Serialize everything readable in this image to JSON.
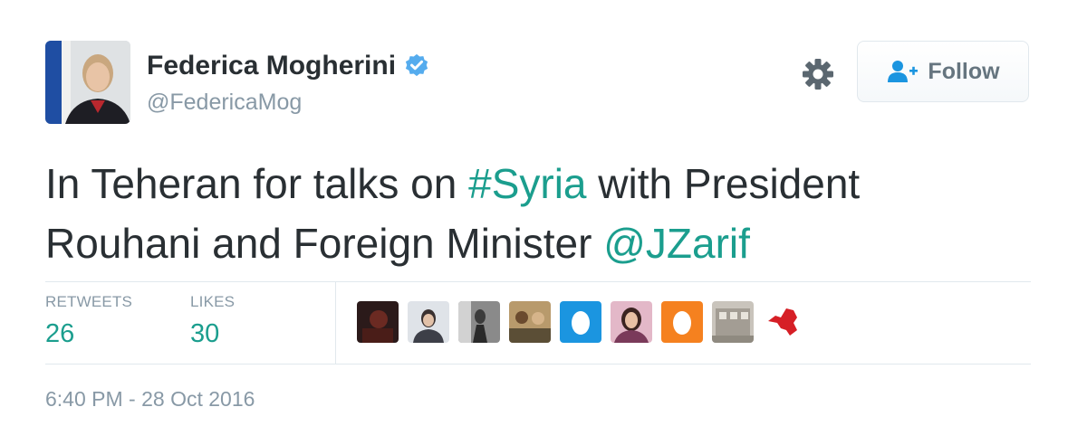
{
  "tweet": {
    "author": {
      "display_name": "Federica Mogherini",
      "handle": "@FedericaMog",
      "verified": true,
      "avatar_icon": "profile-photo"
    },
    "actions": {
      "settings_icon": "gear-icon",
      "follow_icon": "add-user-icon",
      "follow_label": "Follow"
    },
    "text": {
      "line1_before": "In Teheran for talks on ",
      "hashtag": "#Syria",
      "line1_after": " with President",
      "line2_before": "Rouhani and Foreign Minister ",
      "mention": "@JZarif"
    },
    "stats": {
      "retweets_label": "RETWEETS",
      "retweets_count": "26",
      "likes_label": "LIKES",
      "likes_count": "30"
    },
    "timestamp": "6:40 PM - 28 Oct 2016"
  },
  "colors": {
    "link": "#1b9e8e",
    "verified": "#55acee",
    "muted": "#8899a6",
    "text": "#292f33",
    "default_avatar_blue": "#1b95e0",
    "default_avatar_orange": "#f5811f"
  }
}
